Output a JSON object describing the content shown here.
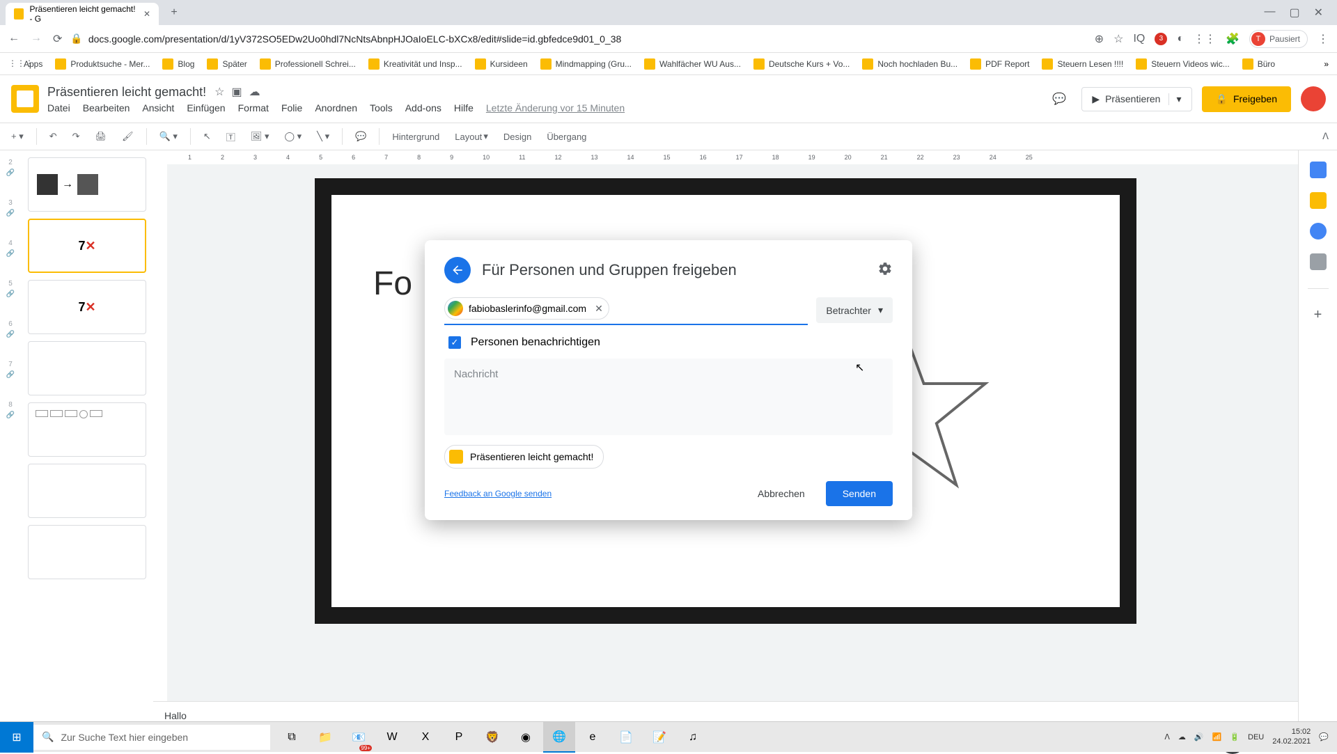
{
  "browser": {
    "tab_title": "Präsentieren leicht gemacht! - G",
    "url": "docs.google.com/presentation/d/1yV372SO5EDw2Uo0hdl7NcNtsAbnpHJOaIoELC-bXCx8/edit#slide=id.gbfedce9d01_0_38",
    "profile_status": "Pausiert",
    "bookmarks": [
      "Apps",
      "Produktsuche - Mer...",
      "Blog",
      "Später",
      "Professionell Schrei...",
      "Kreativität und Insp...",
      "Kursideen",
      "Mindmapping (Gru...",
      "Wahlfächer WU Aus...",
      "Deutsche Kurs + Vo...",
      "Noch hochladen Bu...",
      "PDF Report",
      "Steuern Lesen !!!!",
      "Steuern Videos wic...",
      "Büro"
    ]
  },
  "app": {
    "doc_title": "Präsentieren leicht gemacht!",
    "menus": [
      "Datei",
      "Bearbeiten",
      "Ansicht",
      "Einfügen",
      "Format",
      "Folie",
      "Anordnen",
      "Tools",
      "Add-ons",
      "Hilfe"
    ],
    "last_edit": "Letzte Änderung vor 15 Minuten",
    "present_label": "Präsentieren",
    "share_label": "Freigeben",
    "toolbar": {
      "background": "Hintergrund",
      "layout": "Layout",
      "design": "Design",
      "transition": "Übergang"
    },
    "ruler_marks": [
      "1",
      "2",
      "3",
      "4",
      "5",
      "6",
      "7",
      "8",
      "9",
      "10",
      "11",
      "12",
      "13",
      "14",
      "15",
      "16",
      "17",
      "18",
      "19",
      "20",
      "21",
      "22",
      "23",
      "24",
      "25"
    ],
    "slide_text": "Fo",
    "notes": "Hallo",
    "thumbnails_count": 8
  },
  "modal": {
    "title": "Für Personen und Gruppen freigeben",
    "recipient_email": "fabiobaslerinfo@gmail.com",
    "role": "Betrachter",
    "notify_label": "Personen benachrichtigen",
    "notify_checked": true,
    "message_placeholder": "Nachricht",
    "attachment_name": "Präsentieren leicht gemacht!",
    "feedback_link": "Feedback an Google senden",
    "cancel_label": "Abbrechen",
    "send_label": "Senden"
  },
  "taskbar": {
    "search_placeholder": "Zur Suche Text hier eingeben",
    "badge": "99+",
    "lang": "DEU",
    "time": "15:02",
    "date": "24.02.2021"
  }
}
